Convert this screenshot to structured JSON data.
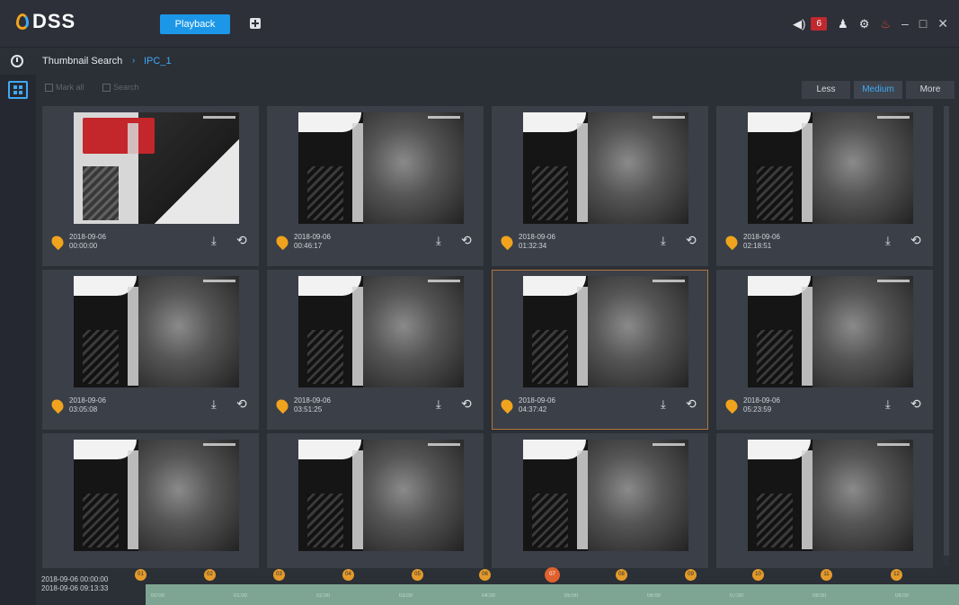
{
  "app": {
    "logo_text": "DSS",
    "active_tab": "Playback"
  },
  "titlebar": {
    "alarm_count": "6",
    "icons": [
      "volume-icon",
      "user-icon",
      "gear-icon",
      "alarm-bell-icon",
      "minimize-icon",
      "restore-icon",
      "close-icon"
    ]
  },
  "breadcrumb": {
    "root": "Thumbnail Search",
    "separator": "›",
    "current": "IPC_1"
  },
  "toolbar": {
    "btn1": "Mark all",
    "btn2": "Search",
    "density": [
      "Less",
      "Medium",
      "More"
    ],
    "density_selected": "Medium"
  },
  "thumbnails": [
    {
      "date": "2018-09-06",
      "time": "00:00:00"
    },
    {
      "date": "2018-09-06",
      "time": "00:46:17"
    },
    {
      "date": "2018-09-06",
      "time": "01:32:34"
    },
    {
      "date": "2018-09-06",
      "time": "02:18:51"
    },
    {
      "date": "2018-09-06",
      "time": "03:05:08"
    },
    {
      "date": "2018-09-06",
      "time": "03:51:25"
    },
    {
      "date": "2018-09-06",
      "time": "04:37:42"
    },
    {
      "date": "2018-09-06",
      "time": "05:23:59"
    },
    {
      "date": "",
      "time": ""
    },
    {
      "date": "",
      "time": ""
    },
    {
      "date": "",
      "time": ""
    },
    {
      "date": "",
      "time": ""
    }
  ],
  "selected_thumbnail": 7,
  "timeline": {
    "start": "2018-09-06 00:00:00",
    "end": "2018-09-06 09:13:33",
    "markers": [
      "01",
      "02",
      "03",
      "04",
      "05",
      "06",
      "07",
      "08",
      "09",
      "10",
      "11",
      "12"
    ],
    "current_marker": "07",
    "ticks": [
      "00:00",
      "01:00",
      "02:00",
      "03:00",
      "04:00",
      "05:00",
      "06:00",
      "07:00",
      "08:00",
      "09:00"
    ]
  },
  "colors": {
    "accent": "#1c97e8",
    "marker": "#e39a2a",
    "current_marker": "#e0612f",
    "timeline_fill": "#7ea593"
  }
}
